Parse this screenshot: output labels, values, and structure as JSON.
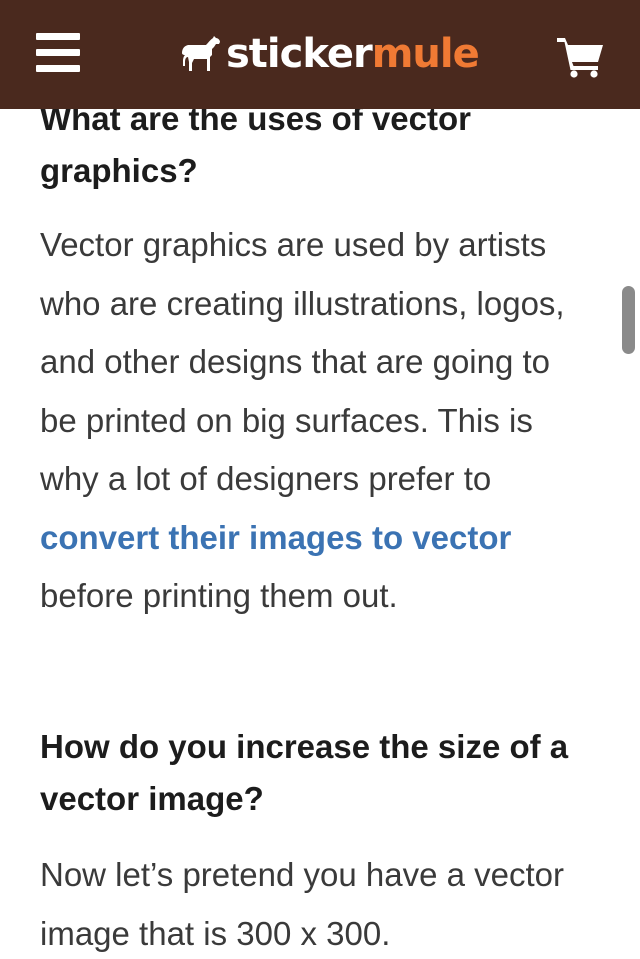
{
  "header": {
    "logo_text_part1": "sticker",
    "logo_text_part2": "mule",
    "icons": {
      "menu": "hamburger-menu-icon",
      "logo": "mule-logo-icon",
      "cart": "shopping-cart-icon"
    },
    "colors": {
      "background": "#4a291e",
      "brand_orange": "#f07a34"
    }
  },
  "article": {
    "heading1": "What are the uses of vector graphics?",
    "para1_before": "Vector graphics are used by artists who are creating illustrations, logos, and other designs that are going to be printed on big surfaces. This is why a lot of designers prefer to ",
    "para1_link": "convert their images to vector",
    "para1_after": " before printing them out.",
    "heading2": "How do you increase the size of a vector image?",
    "para2": "Now let’s pretend you have a vector image that is 300 x 300.",
    "colors": {
      "link": "#3b73b3",
      "text": "#3a3a3a",
      "heading": "#1c1c1c"
    }
  }
}
